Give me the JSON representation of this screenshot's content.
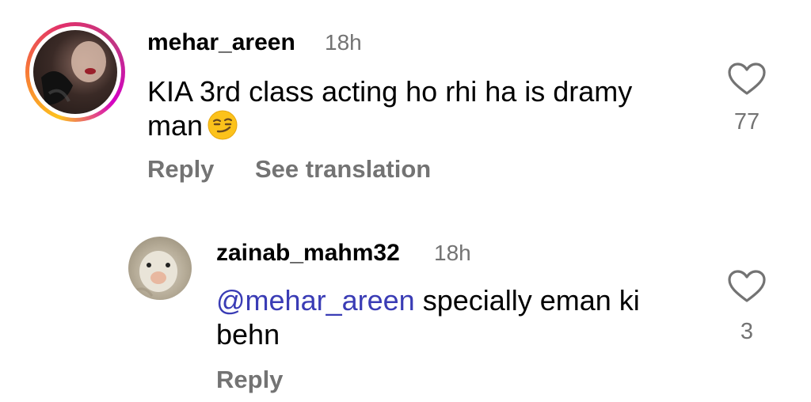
{
  "comments": [
    {
      "username": "mehar_areen",
      "time": "18h",
      "text": "KIA 3rd class acting ho rhi ha is dramy man",
      "emoji": "smirking-face",
      "likes": "77",
      "actions": {
        "reply": "Reply",
        "translate": "See translation"
      }
    },
    {
      "username": "zainab_mahm32",
      "time": "18h",
      "mention": "@mehar_areen",
      "text": " specially eman ki behn",
      "likes": "3",
      "actions": {
        "reply": "Reply"
      }
    }
  ],
  "colors": {
    "secondary_text": "#737373",
    "mention": "#3a3cb5",
    "story_ring_start": "#fdc21e",
    "story_ring_end": "#d300c5"
  }
}
